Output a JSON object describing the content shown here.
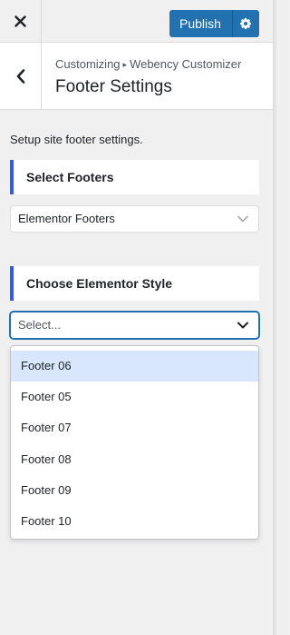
{
  "header": {
    "close_icon": "close-icon",
    "publish_label": "Publish",
    "gear_icon": "gear-icon",
    "accent_color": "#2271b1"
  },
  "titlebar": {
    "back_icon": "chevron-left-icon",
    "breadcrumb_root": "Customizing",
    "breadcrumb_separator": "▸",
    "breadcrumb_section": "Webency Customizer",
    "title": "Footer Settings"
  },
  "content": {
    "description": "Setup site footer settings.",
    "select_footers": {
      "heading": "Select Footers",
      "value": "Elementor Footers"
    },
    "elementor_style": {
      "heading": "Choose Elementor Style",
      "placeholder": "Select...",
      "options": [
        "Footer 06",
        "Footer 05",
        "Footer 07",
        "Footer 08",
        "Footer 09",
        "Footer 10"
      ],
      "highlighted_option": "Footer 06"
    },
    "section_border_color": "#3858e9"
  }
}
